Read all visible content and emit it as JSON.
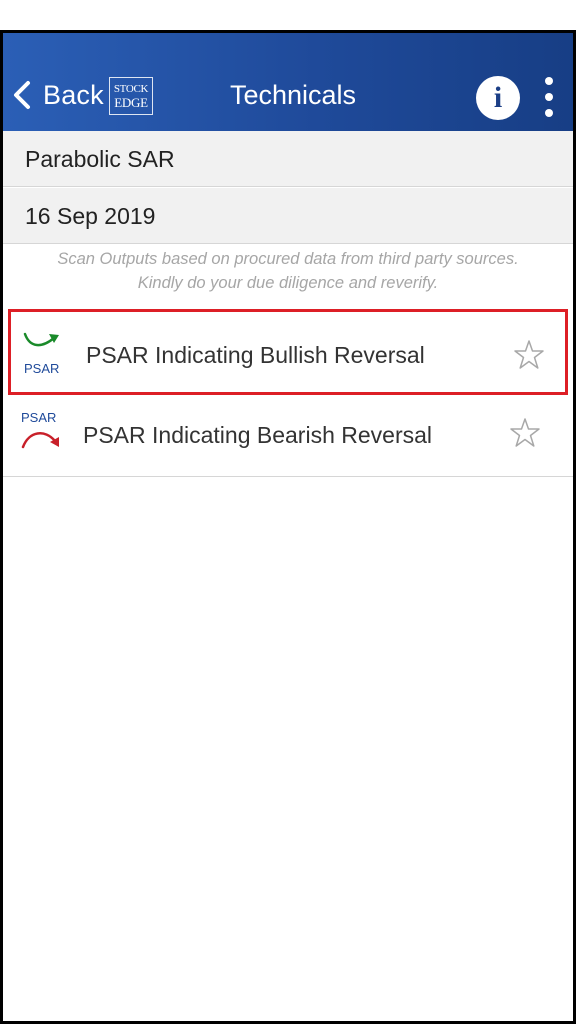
{
  "header": {
    "back_label": "Back",
    "logo_line1": "STOCK",
    "logo_line2": "EDGE",
    "title": "Technicals",
    "info_glyph": "i",
    "icons": [
      "chevron-left-icon",
      "info-icon",
      "more-vertical-icon"
    ],
    "colors": {
      "bar": "#1f4a9a",
      "text": "#ffffff"
    }
  },
  "indicator": "Parabolic SAR",
  "date": "16 Sep 2019",
  "disclaimer": {
    "line1": "Scan Outputs based on procured data from third party sources.",
    "line2": "Kindly do your due diligence and reverify."
  },
  "scans": [
    {
      "label": "PSAR Indicating Bullish Reversal",
      "icon_text": "PSAR",
      "icon": "psar-bullish-icon",
      "starred": false,
      "highlighted": true
    },
    {
      "label": "PSAR Indicating Bearish Reversal",
      "icon_text": "PSAR",
      "icon": "psar-bearish-icon",
      "starred": false,
      "highlighted": false
    }
  ],
  "colors": {
    "bullish": "#1a8a2a",
    "bearish": "#c8202a",
    "highlight_border": "#dd1f26",
    "psar_text": "#1f4a9a"
  }
}
